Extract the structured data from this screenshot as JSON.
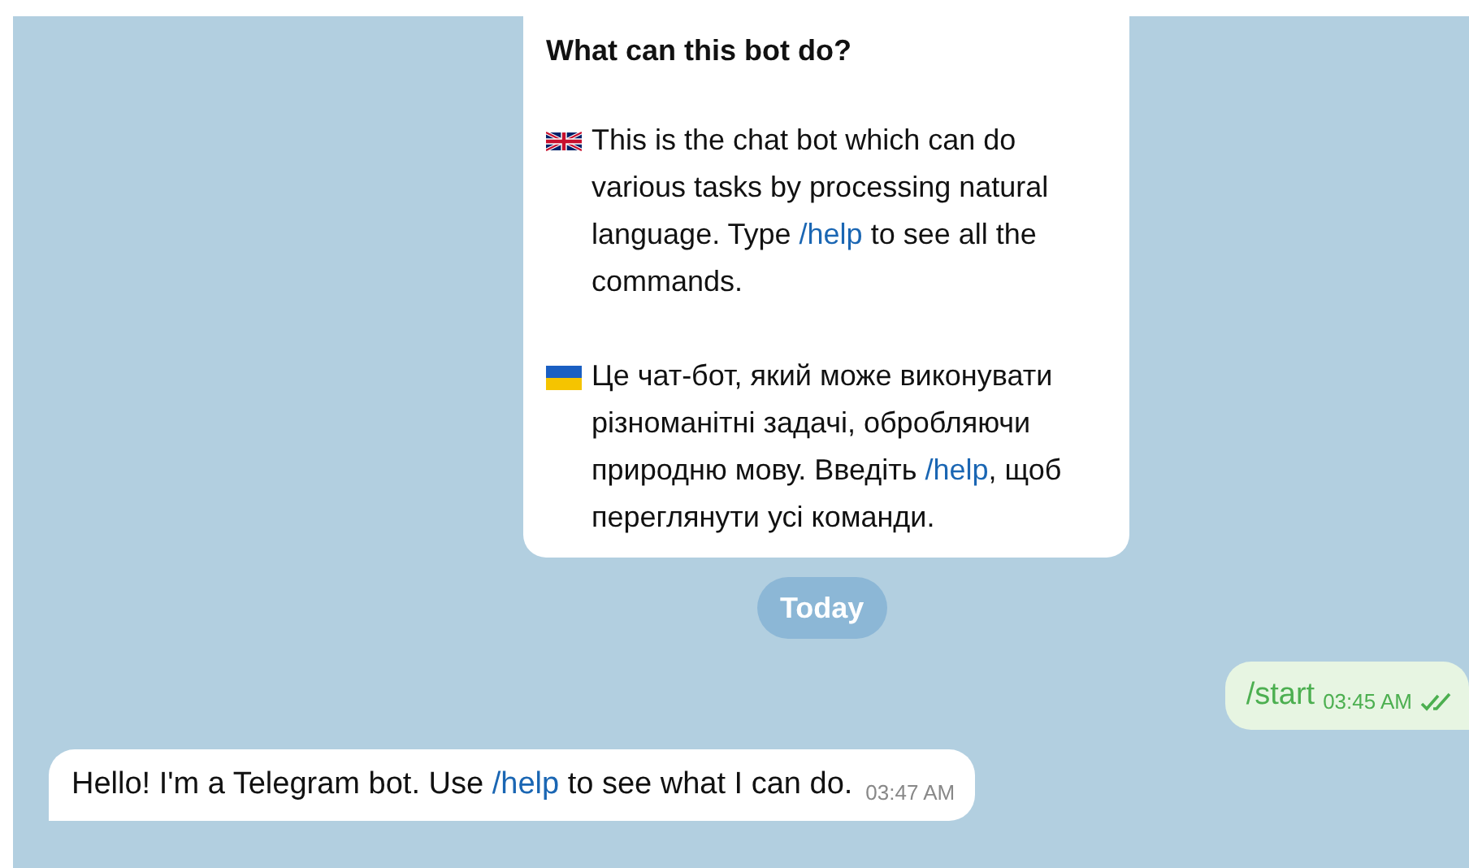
{
  "intro_card": {
    "title": "What can this bot do?",
    "paragraphs": [
      {
        "kind": "english",
        "before": "This is the chat bot which can do various tasks by processing natural language. Type ",
        "link": "/help",
        "after": " to see all the commands."
      },
      {
        "kind": "ukrainian",
        "before": "Це чат-бот, який може виконувати різноманітні задачі, обробляючи природню мову. Введіть ",
        "link": "/help",
        "after": ", щоб переглянути усі команди."
      }
    ]
  },
  "date_pill": "Today",
  "messages": [
    {
      "kind": "outgoing",
      "text": "/start",
      "time": "03:45 AM",
      "read": true
    },
    {
      "kind": "incoming",
      "before": "Hello! I'm a Telegram bot. Use ",
      "link": "/help",
      "after": " to see what I can do.",
      "time": "03:47 AM"
    }
  ]
}
